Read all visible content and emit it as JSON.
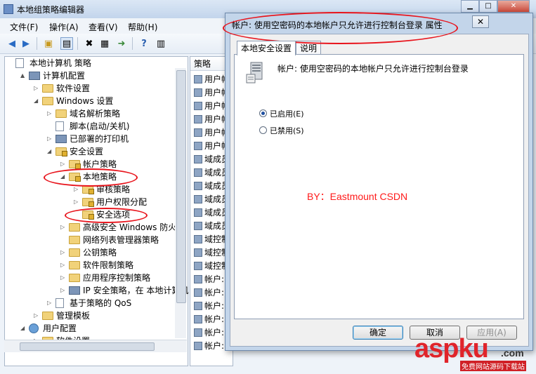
{
  "main_window": {
    "title": "本地组策略编辑器",
    "menu": [
      "文件(F)",
      "操作(A)",
      "查看(V)",
      "帮助(H)"
    ]
  },
  "tree": [
    {
      "label": "本地计算机 策略",
      "depth": 0,
      "icon": "doc-icon",
      "arrow": ""
    },
    {
      "label": "计算机配置",
      "depth": 1,
      "icon": "pc-icon",
      "arrow": "▲"
    },
    {
      "label": "软件设置",
      "depth": 2,
      "icon": "folder-icon",
      "arrow": "▷"
    },
    {
      "label": "Windows 设置",
      "depth": 2,
      "icon": "folder-icon",
      "arrow": "◢"
    },
    {
      "label": "域名解析策略",
      "depth": 3,
      "icon": "folder-icon",
      "arrow": "▷"
    },
    {
      "label": "脚本(启动/关机)",
      "depth": 3,
      "icon": "doc-icon",
      "arrow": ""
    },
    {
      "label": "已部署的打印机",
      "depth": 3,
      "icon": "printer-icon",
      "arrow": "▷"
    },
    {
      "label": "安全设置",
      "depth": 3,
      "icon": "lock-folder-icon",
      "arrow": "◢"
    },
    {
      "label": "帐户策略",
      "depth": 4,
      "icon": "lock-folder-icon",
      "arrow": "▷"
    },
    {
      "label": "本地策略",
      "depth": 4,
      "icon": "lock-folder-icon",
      "arrow": "◢"
    },
    {
      "label": "审核策略",
      "depth": 5,
      "icon": "lock-folder-icon",
      "arrow": "▷"
    },
    {
      "label": "用户权限分配",
      "depth": 5,
      "icon": "lock-folder-icon",
      "arrow": "▷"
    },
    {
      "label": "安全选项",
      "depth": 5,
      "icon": "lock-folder-icon",
      "arrow": ""
    },
    {
      "label": "高级安全 Windows 防火墙",
      "depth": 4,
      "icon": "folder-icon",
      "arrow": "▷"
    },
    {
      "label": "网络列表管理器策略",
      "depth": 4,
      "icon": "folder-icon",
      "arrow": ""
    },
    {
      "label": "公钥策略",
      "depth": 4,
      "icon": "folder-icon",
      "arrow": "▷"
    },
    {
      "label": "软件限制策略",
      "depth": 4,
      "icon": "folder-icon",
      "arrow": "▷"
    },
    {
      "label": "应用程序控制策略",
      "depth": 4,
      "icon": "folder-icon",
      "arrow": "▷"
    },
    {
      "label": "IP 安全策略，在 本地计算机",
      "depth": 4,
      "icon": "shield-icon",
      "arrow": "▷"
    },
    {
      "label": "基于策略的 QoS",
      "depth": 3,
      "icon": "chart-icon",
      "arrow": "▷"
    },
    {
      "label": "管理模板",
      "depth": 2,
      "icon": "folder-icon",
      "arrow": "▷"
    },
    {
      "label": "用户配置",
      "depth": 1,
      "icon": "user-icon",
      "arrow": "◢"
    },
    {
      "label": "软件设置",
      "depth": 2,
      "icon": "folder-icon",
      "arrow": "▷"
    }
  ],
  "list": {
    "header": "策略",
    "rows": [
      "用户帐",
      "用户帐",
      "用户帐",
      "用户帐",
      "用户帐",
      "用户帐",
      "域成员",
      "域成员",
      "域成员",
      "域成员",
      "域成员",
      "域成员",
      "域控制",
      "域控制",
      "域控制",
      "帐户:",
      "帐户:",
      "帐户:",
      "帐户:",
      "帐户:",
      "帐户:"
    ]
  },
  "dialog": {
    "title": "帐户: 使用空密码的本地帐户只允许进行控制台登录 属性",
    "close": "✕",
    "tabs": [
      "本地安全设置",
      "说明"
    ],
    "policy_title": "帐户: 使用空密码的本地帐户只允许进行控制台登录",
    "options": [
      {
        "label": "已启用(E)",
        "selected": true
      },
      {
        "label": "已禁用(S)",
        "selected": false
      }
    ],
    "buttons": {
      "ok": "确定",
      "cancel": "取消",
      "apply": "应用(A)"
    }
  },
  "watermark": {
    "text": "BY：Eastmount CSDN",
    "color": "#ff1a1a"
  },
  "site_logo": {
    "brand": "aspku",
    "tld": ".com",
    "sub": "免费网站源码下载站"
  },
  "annotation_color": "#e8141c"
}
